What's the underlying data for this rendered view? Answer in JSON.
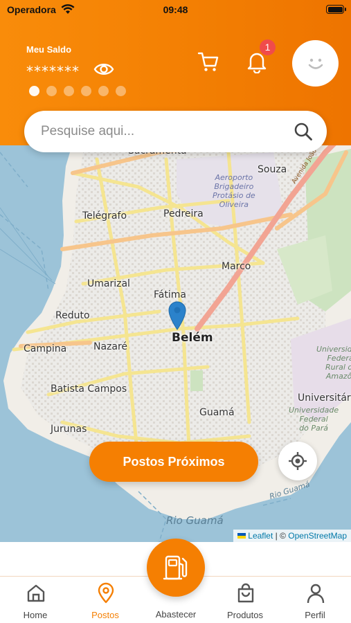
{
  "status_bar": {
    "carrier": "Operadora",
    "time": "09:48"
  },
  "header": {
    "balance_label": "Meu Saldo",
    "balance_value": "*******",
    "notification_count": "1",
    "carousel_dots": 6,
    "carousel_active_index": 0
  },
  "search": {
    "placeholder": "Pesquise aqui..."
  },
  "map": {
    "places": [
      "Sacramenta",
      "Souza",
      "Telégrafo",
      "Pedreira",
      "Marco",
      "Umarizal",
      "Fátima",
      "Reduto",
      "Belém",
      "Campina",
      "Nazaré",
      "Batista Campos",
      "Guamá",
      "Jurunas",
      "Universitár"
    ],
    "airport_label": "Aeroporto\nBrigadeiro\nProtásio de\nOliveira",
    "university_labels": [
      "Universidade\nFederal\nRural da\nAmazôn",
      "Universidade\nFederal\ndo Pará"
    ],
    "water_labels": [
      "Rio Guamá",
      "Rio Guamá"
    ],
    "road_label": "Avenida João Paulo II",
    "attribution": {
      "leaflet": "Leaflet",
      "separator": " | © ",
      "osm": "OpenStreetMap"
    }
  },
  "buttons": {
    "nearby": "Postos Próximos"
  },
  "nav": {
    "items": [
      {
        "label": "Home",
        "icon": "home-icon"
      },
      {
        "label": "Postos",
        "icon": "location-pin-icon",
        "active": true
      },
      {
        "label": "Abastecer",
        "icon": "fuel-pump-icon"
      },
      {
        "label": "Produtos",
        "icon": "shopping-bag-icon"
      },
      {
        "label": "Perfil",
        "icon": "user-icon"
      }
    ]
  },
  "colors": {
    "brand_orange": "#f57f02",
    "badge_red": "#f04b4b",
    "water": "#9cc3d8",
    "land": "#f2efe9"
  }
}
